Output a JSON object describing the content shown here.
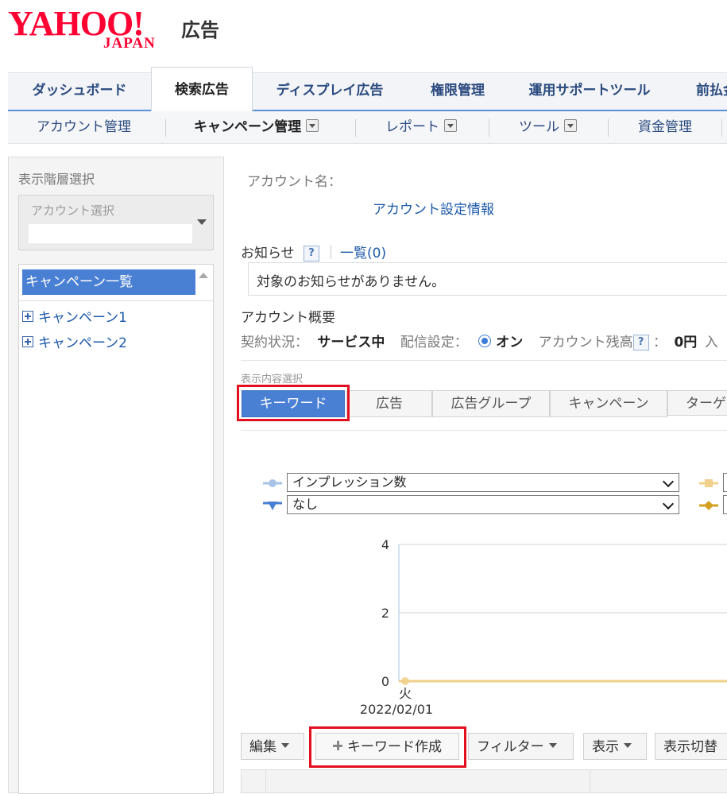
{
  "logo": {
    "yahoo": "YAHOO!",
    "japan": "JAPAN",
    "ad": "広告"
  },
  "main_tabs": [
    {
      "label": "ダッシュボード"
    },
    {
      "label": "検索広告"
    },
    {
      "label": "ディスプレイ広告"
    },
    {
      "label": "権限管理"
    },
    {
      "label": "運用サポートツール"
    },
    {
      "label": "前払金"
    }
  ],
  "sub_nav": [
    {
      "label": "アカウント管理"
    },
    {
      "label": "キャンペーン管理"
    },
    {
      "label": "レポート"
    },
    {
      "label": "ツール"
    },
    {
      "label": "資金管理"
    }
  ],
  "left_panel": {
    "title": "表示階層選択",
    "account_select_label": "アカウント選択",
    "account_select_value": "",
    "tree_header": "キャンペーン一覧",
    "campaigns": [
      "キャンペーン1",
      "キャンペーン2"
    ]
  },
  "account": {
    "name_label": "アカウント名：",
    "settings_link": "アカウント設定情報"
  },
  "notice": {
    "title": "お知らせ",
    "help": "?",
    "list_link": "一覧(0)",
    "message": "対象のお知らせがありません。"
  },
  "overview": {
    "title": "アカウント概要",
    "contract_label": "契約状況：",
    "contract_value": "サービス中",
    "delivery_label": "配信設定：",
    "delivery_value": "オン",
    "balance_label": "アカウント残高",
    "balance_sep": "：",
    "balance_value": "0円",
    "balance_tail": "入"
  },
  "display_content": {
    "label": "表示内容選択",
    "tabs": [
      "キーワード",
      "広告",
      "広告グループ",
      "キャンペーン",
      "ターゲ"
    ],
    "active_tab": "キーワード"
  },
  "chart_controls": {
    "metric1": "インプレッション数",
    "metric2": "なし",
    "colors": {
      "metric1": "#a7c4e6",
      "metric2": "#4a80d4",
      "metric3": "#f0d08a",
      "metric4": "#d4a020"
    }
  },
  "chart_data": {
    "type": "line",
    "categories": [
      "火\n2022/02/01"
    ],
    "x_tick_day": "火",
    "x_tick_date": "2022/02/01",
    "y_ticks": [
      "4",
      "2",
      "0"
    ],
    "ylim": [
      0,
      4
    ],
    "series": [
      {
        "values": [
          0
        ],
        "color": "#f0d08a"
      }
    ],
    "grid": true
  },
  "toolbar": {
    "edit": "編集",
    "create_keyword": "キーワード作成",
    "filter": "フィルター",
    "display": "表示",
    "display_toggle": "表示切替"
  }
}
